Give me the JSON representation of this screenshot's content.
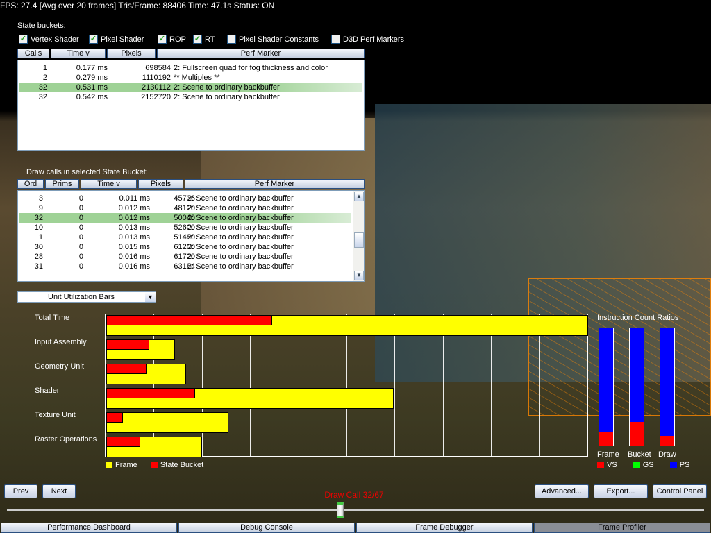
{
  "status": "FPS: 27.4 [Avg over 20 frames]   Tris/Frame:   88406   Time: 47.1s   Status: ON",
  "state_buckets": {
    "label": "State buckets:",
    "checkboxes": [
      {
        "label": "Vertex Shader",
        "checked": true
      },
      {
        "label": "Pixel Shader",
        "checked": true
      },
      {
        "label": "ROP",
        "checked": true
      },
      {
        "label": "RT",
        "checked": true
      },
      {
        "label": "Pixel Shader Constants",
        "checked": false
      },
      {
        "label": "D3D Perf Markers",
        "checked": false
      }
    ],
    "columns": [
      "Calls",
      "Time  v",
      "Pixels",
      "Perf Marker"
    ],
    "rows": [
      [
        "1",
        "0.177 ms",
        "698584",
        "2: Fullscreen quad for fog thickness and color"
      ],
      [
        "2",
        "0.279 ms",
        "1110192",
        "** Multiples **"
      ],
      [
        "32",
        "0.531 ms",
        "2130112",
        "2: Scene to ordinary backbuffer"
      ],
      [
        "32",
        "0.542 ms",
        "2152720",
        "2: Scene to ordinary backbuffer"
      ]
    ],
    "selected_index": 2
  },
  "draw_calls": {
    "label": "Draw calls in selected State Bucket:",
    "columns": [
      "Ord",
      "Prims",
      "Time  v",
      "Pixels",
      "Perf Marker"
    ],
    "rows": [
      [
        "3",
        "0",
        "0.011 ms",
        "45736",
        "2: Scene to ordinary backbuffer"
      ],
      [
        "9",
        "0",
        "0.012 ms",
        "48120",
        "2: Scene to ordinary backbuffer"
      ],
      [
        "32",
        "0",
        "0.012 ms",
        "50040",
        "2: Scene to ordinary backbuffer"
      ],
      [
        "10",
        "0",
        "0.013 ms",
        "52600",
        "2: Scene to ordinary backbuffer"
      ],
      [
        "1",
        "0",
        "0.013 ms",
        "51480",
        "2: Scene to ordinary backbuffer"
      ],
      [
        "30",
        "0",
        "0.015 ms",
        "61200",
        "2: Scene to ordinary backbuffer"
      ],
      [
        "28",
        "0",
        "0.016 ms",
        "61720",
        "2: Scene to ordinary backbuffer"
      ],
      [
        "31",
        "0",
        "0.016 ms",
        "63184",
        "2: Scene to ordinary backbuffer"
      ]
    ],
    "selected_index": 2
  },
  "view_select": {
    "value": "Unit Utilization Bars"
  },
  "chart_data": [
    {
      "type": "bar",
      "orientation": "horizontal",
      "categories": [
        "Total Time",
        "Input Assembly",
        "Geometry Unit",
        "Shader",
        "Texture Unit",
        "Raster Operations"
      ],
      "series": [
        {
          "name": "Frame",
          "color": "#ffff00",
          "values": [
            100,
            14.3,
            16.5,
            59.7,
            25.4,
            19.9
          ]
        },
        {
          "name": "State Bucket",
          "color": "#ff0000",
          "values": [
            34.5,
            9,
            8.3,
            18.5,
            3.5,
            7.1
          ]
        }
      ],
      "xlim": [
        0,
        100
      ],
      "grid": true,
      "legend": "bottom-left"
    },
    {
      "type": "bar",
      "title": "Instruction Count Ratios",
      "categories": [
        "Frame",
        "Bucket",
        "Draw"
      ],
      "series": [
        {
          "name": "VS",
          "color": "#ff0000",
          "values": [
            12,
            20,
            8
          ]
        },
        {
          "name": "GS",
          "color": "#00ff00",
          "values": [
            0,
            0,
            0
          ]
        },
        {
          "name": "PS",
          "color": "#0000ff",
          "values": [
            88,
            80,
            92
          ]
        }
      ],
      "ylim": [
        0,
        100
      ],
      "stacked": true,
      "legend": "bottom"
    }
  ],
  "buttons": {
    "prev": "Prev",
    "next": "Next",
    "advanced": "Advanced...",
    "export": "Export...",
    "control_panel": "Control Panel"
  },
  "slider": {
    "label": "Draw Call 32/67",
    "value": 32,
    "max": 67
  },
  "tabs": [
    {
      "label": "Performance Dashboard"
    },
    {
      "label": "Debug Console"
    },
    {
      "label": "Frame Debugger"
    },
    {
      "label": "Frame Profiler",
      "active": true
    }
  ]
}
